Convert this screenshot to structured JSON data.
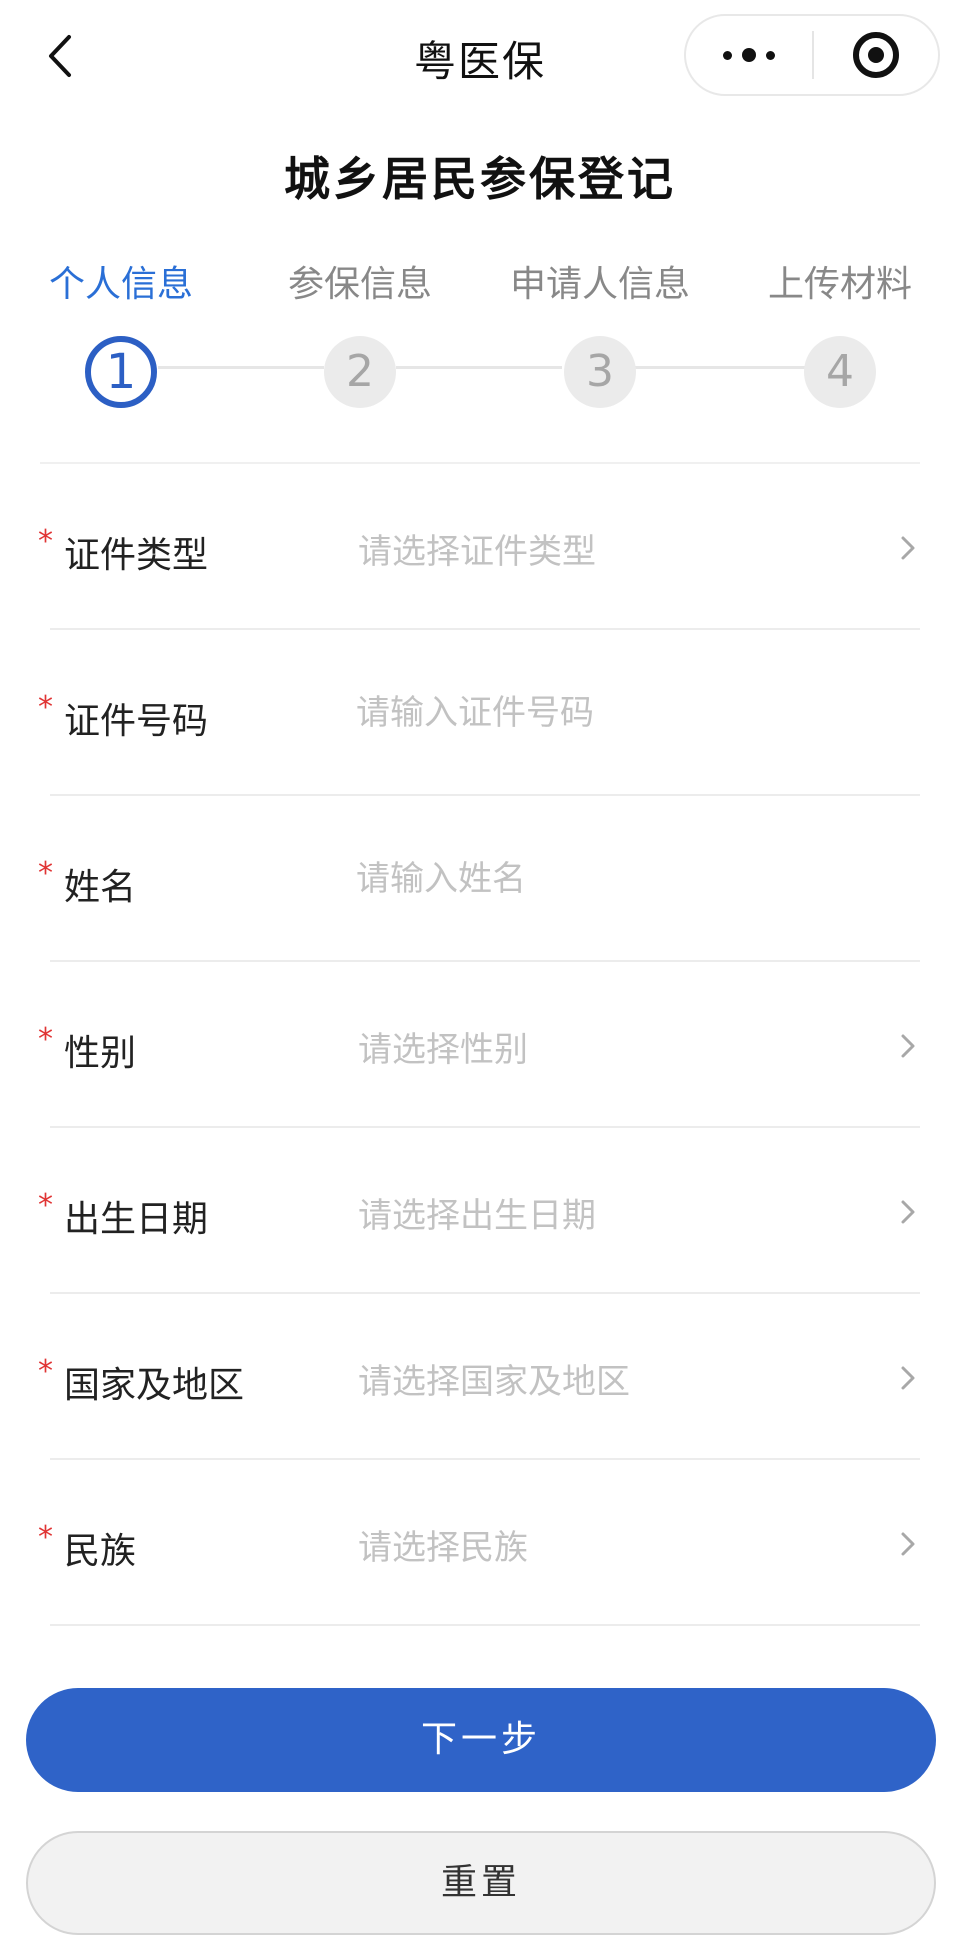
{
  "nav": {
    "title": "粤医保"
  },
  "page": {
    "title": "城乡居民参保登记"
  },
  "steps": [
    {
      "label": "个人信息",
      "number": "1",
      "active": true
    },
    {
      "label": "参保信息",
      "number": "2",
      "active": false
    },
    {
      "label": "申请人信息",
      "number": "3",
      "active": false
    },
    {
      "label": "上传材料",
      "number": "4",
      "active": false
    }
  ],
  "form": {
    "required_mark": "*",
    "fields": [
      {
        "label": "证件类型",
        "type": "select",
        "placeholder": "请选择证件类型"
      },
      {
        "label": "证件号码",
        "type": "input",
        "placeholder": "请输入证件号码"
      },
      {
        "label": "姓名",
        "type": "input",
        "placeholder": "请输入姓名"
      },
      {
        "label": "性别",
        "type": "select",
        "placeholder": "请选择性别"
      },
      {
        "label": "出生日期",
        "type": "select",
        "placeholder": "请选择出生日期"
      },
      {
        "label": "国家及地区",
        "type": "select",
        "placeholder": "请选择国家及地区"
      },
      {
        "label": "民族",
        "type": "select",
        "placeholder": "请选择民族"
      }
    ]
  },
  "buttons": {
    "next": "下一步",
    "reset": "重置"
  },
  "colors": {
    "primary": "#2f63c8",
    "active_step": "#2a6fd6",
    "required": "#e03434",
    "placeholder": "#c2c2c2"
  }
}
